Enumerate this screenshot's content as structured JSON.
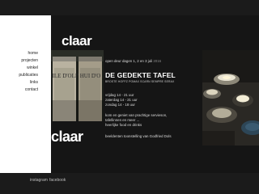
{
  "brand": {
    "logo_top": "claar",
    "logo_bottom": "claar"
  },
  "nav": {
    "items": [
      {
        "label": "home"
      },
      {
        "label": "projecten"
      },
      {
        "label": "winkel"
      },
      {
        "label": "publicaties"
      },
      {
        "label": "links"
      },
      {
        "label": "contact"
      }
    ]
  },
  "event": {
    "open_line": "open deur dagen 1, 2 en 3 juli",
    "open_year": "2016",
    "title": "DE GEDEKTE TAFEL",
    "subtitle": "BROSTE HOFFZ POMAX SCARN SEMPRE SERAX",
    "hours": [
      "vrijdag 14 - 21 uur",
      "zaterdag 14 - 21 uur",
      "zondag 14 - 18 uur"
    ],
    "description": [
      "kom en geniet van prachtige servieson,",
      "tafellinnen en meer ...",
      "heerlijke food en drinks"
    ],
    "credit": "beeldenten toonstelling van Godfried Dols"
  },
  "photos": {
    "left_jar_1": "HUILE D'OLIVE",
    "left_jar_2": "HUI D'O"
  },
  "footer": {
    "instagram": "instagram",
    "facebook": "facebook"
  },
  "colors": {
    "bars": "#1b1b1b",
    "hero_bg": "#151515",
    "accent_year": "#8a8a8a"
  }
}
